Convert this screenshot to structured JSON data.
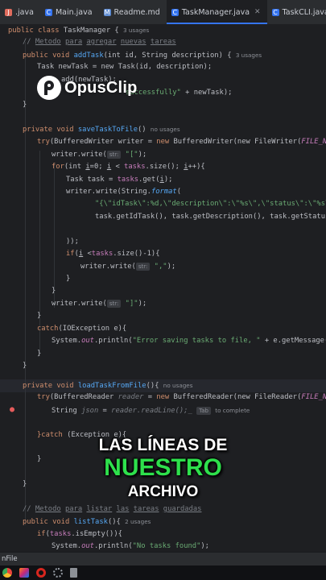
{
  "tabs": [
    {
      "label": ".java",
      "icon": "java-file-icon",
      "icon_color": "#e06c5d",
      "active": false
    },
    {
      "label": "Main.java",
      "icon": "java-class-icon",
      "icon_color": "#3574f0",
      "active": false
    },
    {
      "label": "Readme.md",
      "icon": "markdown-icon",
      "icon_color": "#5f8dd3",
      "active": false
    },
    {
      "label": "TaskManager.java",
      "icon": "java-class-icon",
      "icon_color": "#3574f0",
      "active": true
    },
    {
      "label": "TaskCLI.java",
      "icon": "java-class-icon",
      "icon_color": "#3574f0",
      "active": false
    }
  ],
  "code": {
    "l1": {
      "kw": "public class ",
      "name": "TaskManager",
      "rest": " {",
      "hint": "3 usages"
    },
    "l2": {
      "slash": "// ",
      "w1": "Metodo",
      "s1": " ",
      "w2": "para",
      "s2": " ",
      "w3": "agregar",
      "s3": " ",
      "w4": "nuevas",
      "s4": " ",
      "w5": "tareas"
    },
    "l3": {
      "kw": "public void ",
      "fn": "addTask",
      "rest": "(int id, String description) {",
      "hint": "3 usages"
    },
    "l4": {
      "text": "Task newTask = new Task(id, description);"
    },
    "l5": {
      "text": "add(newTask);"
    },
    "l6": {
      "str": "successfully\"",
      "rest": " + newTask);"
    },
    "l7": {
      "text": "}"
    },
    "l8": {
      "kw": "private void ",
      "fn": "saveTaskToFile",
      "rest": "()",
      "hint": "no usages"
    },
    "l9": {
      "kw": "try",
      "pre": "(BufferedWriter writer = ",
      "kw2": "new ",
      "mid": "BufferedWriter(new FileWriter(",
      "const": "FILE_NAME",
      "rest": "))){"
    },
    "l10": {
      "pre": "writer.write(",
      "pill": "str:",
      "str": " \"[\"",
      "rest": ");"
    },
    "l11": {
      "kw": "for",
      "pre": "(int ",
      "var": "i",
      "mid": "=0; ",
      "var2": "i",
      "mid2": " < ",
      "fld": "tasks",
      "rest": ".size(); ",
      "var3": "i",
      "rest2": "++){"
    },
    "l12": {
      "pre": "Task task = ",
      "fld": "tasks",
      "rest": ".get(",
      "var": "i",
      "rest2": ");"
    },
    "l13": {
      "pre": "writer.write(String.",
      "fn": "format",
      "rest": "("
    },
    "l14": {
      "str": "\"{\\\"idTask\\\":%d,\\\"description\\\":\\\"%s\\\",\\\"status\\\":\\\"%s\\\",\\\"creat"
    },
    "l15": {
      "text": "task.getIdTask(), task.getDescription(), task.getStatus(),task.ge"
    },
    "l16": {
      "text": "));"
    },
    "l17": {
      "kw": "if",
      "pre": "(",
      "var": "i",
      "mid": " <",
      "fld": "tasks",
      "rest": ".size()-1){"
    },
    "l18": {
      "pre": "writer.write(",
      "pill": "str:",
      "str": " \",\"",
      "rest": ");"
    },
    "l19": {
      "text": "}"
    },
    "l20": {
      "text": "}"
    },
    "l21": {
      "pre": "writer.write(",
      "pill": "str:",
      "str": " \"]\"",
      "rest": ");"
    },
    "l22": {
      "text": "}"
    },
    "l23": {
      "kw": "catch",
      "rest": "(IOException e){"
    },
    "l24": {
      "pre": "System.",
      "fld": "out",
      "mid": ".println(",
      "str": "\"Error saving tasks to file, \"",
      "rest": " + e.getMessage());"
    },
    "l25": {
      "text": "}"
    },
    "l26": {
      "text": "}"
    },
    "l27": {
      "kw": "private void ",
      "fn": "loadTaskFromFile",
      "rest": "(){",
      "hint": "no usages"
    },
    "l28": {
      "kw": "try",
      "pre": "(BufferedReader ",
      "dim": "reader",
      "mid": " = ",
      "kw2": "new ",
      "mid2": "BufferedReader(new FileReader(",
      "const": "FILE_NAME",
      "rest": ")) {"
    },
    "l29": {
      "pre": "String ",
      "dim1": "json",
      "mid": " = ",
      "dim2": "reader.readLine();_",
      "pill": "Tab",
      "hint": "to complete"
    },
    "l30": {
      "kw": "}catch",
      "rest": " (Exception e){"
    },
    "l31": {
      "text": "}"
    },
    "l32": {
      "text": "}"
    },
    "l33": {
      "slash": "// ",
      "w1": "Metodo",
      "s1": " ",
      "w2": "para",
      "s2": " ",
      "w3": "listar",
      "s3": " ",
      "w4": "las",
      "s4": " ",
      "w5": "tareas",
      "s5": " ",
      "w6": "guardadas"
    },
    "l34": {
      "kw": "public void ",
      "fn": "listTask",
      "rest": "(){",
      "hint": "2 usages"
    },
    "l35": {
      "kw": "if",
      "pre": "(",
      "fld": "tasks",
      "rest": ".isEmpty()){"
    },
    "l36": {
      "pre": "System.",
      "fld": "out",
      "mid": ".println(",
      "str": "\"No tasks found\"",
      "rest": ");"
    }
  },
  "watermark": {
    "name": "OpusClip",
    "icon": "opusclip-logo-icon"
  },
  "caption": {
    "line1": "LAS LÍNEAS DE",
    "line2": "NUESTRO",
    "line3": "ARCHIVO"
  },
  "statusbar": {
    "text": "nFile"
  },
  "taskbar": [
    {
      "icon": "chrome-icon",
      "color": "#e8a317"
    },
    {
      "icon": "intellij-icon",
      "color": "#c3267d"
    },
    {
      "icon": "opera-icon",
      "color": "#d7261e"
    },
    {
      "icon": "settings-icon",
      "color": "#7b8088"
    },
    {
      "icon": "file-icon",
      "color": "#8c9096"
    }
  ]
}
